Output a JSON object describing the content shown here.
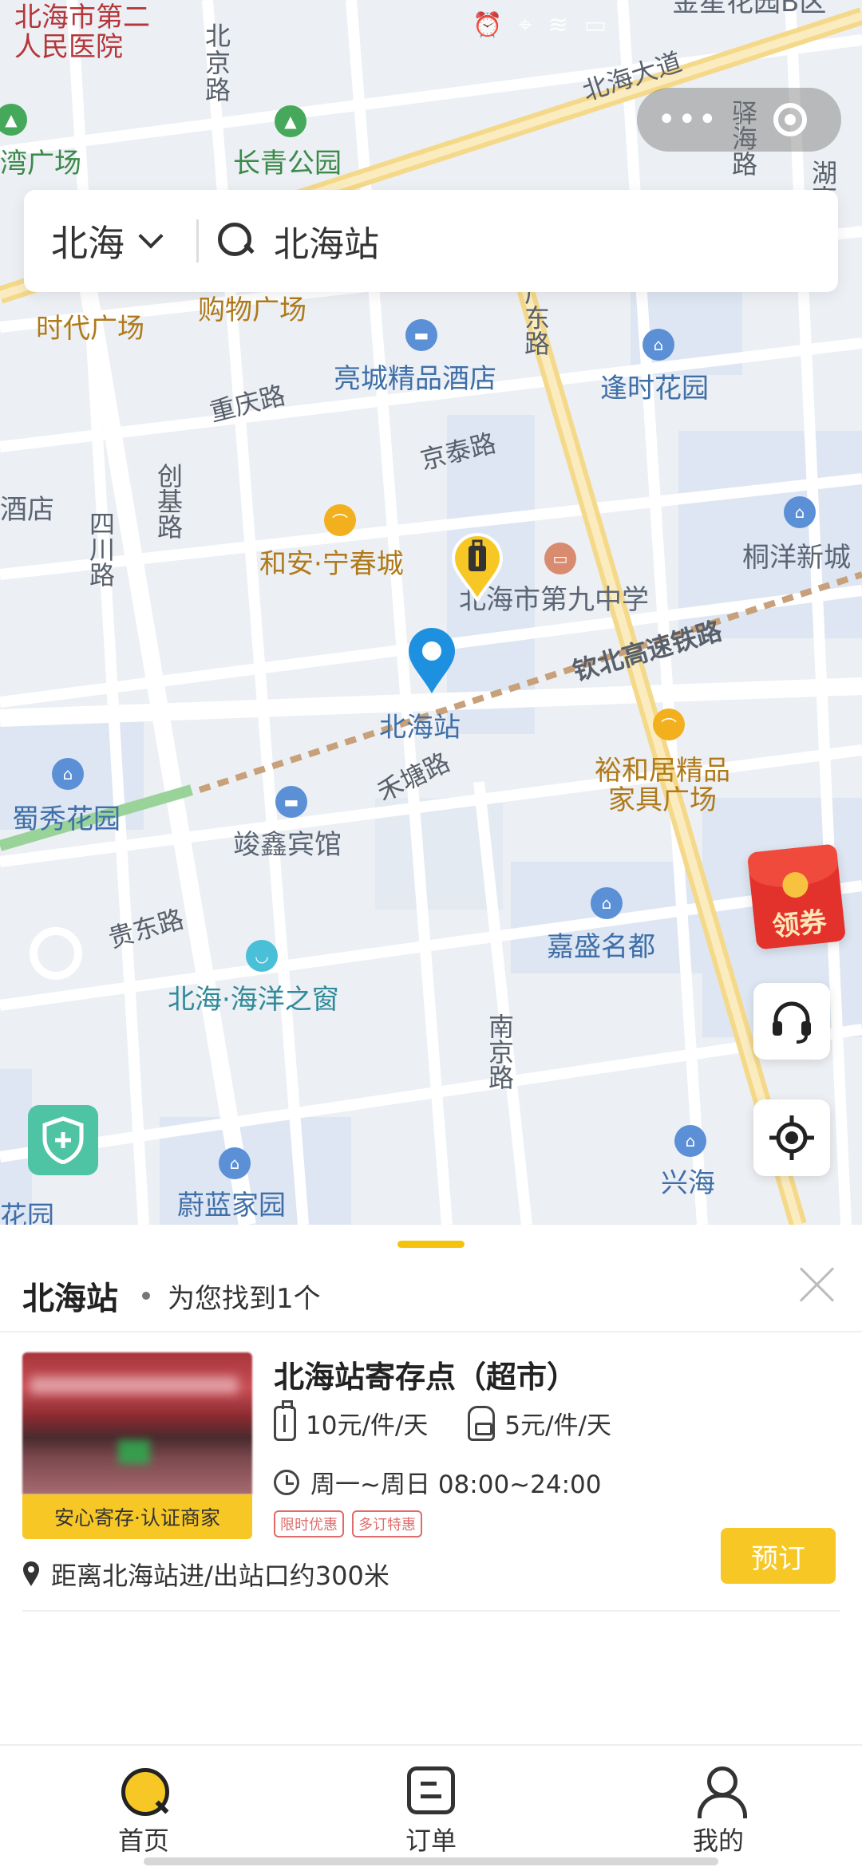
{
  "status_bar": {
    "icons": [
      "alarm-icon",
      "location-icon",
      "wifi-icon",
      "signal-icon",
      "battery-icon"
    ]
  },
  "capsule": {
    "more_label": "•••",
    "close_icon": "record-icon"
  },
  "search": {
    "city": "北海",
    "value": "北海站"
  },
  "map": {
    "labels": {
      "hospital": "北海市第二\n人民医院",
      "beijing_road": "北京路",
      "beihai_avenue": "北海大道",
      "jinxing_garden": "金星花园B区",
      "bay_square": "湾广场",
      "changqing_park": "长青公园",
      "yizhan_road": "驿海路",
      "hubei_road": "湖南路",
      "times_square": "时代广场",
      "shopping_square": "购物广场",
      "liangcheng_hotel": "亮城精品酒店",
      "guangdong_road": "广东路",
      "fengshi_garden": "逢时花园",
      "chongqing_road": "重庆路",
      "jingtai_road": "京泰路",
      "hotel_left": "酒店",
      "chuangji_road": "创基路",
      "sichuan_road": "四川路",
      "hean_ningchun": "和安·宁春城",
      "no9_middle_school": "北海市第九中学",
      "tongyang_new_city": "桐洋新城",
      "qinbei_railway": "钦北高速铁路",
      "beihai_station": "北海站",
      "yuhe_furniture": "裕和居精品\n家具广场",
      "shuxiu_garden": "蜀秀花园",
      "hetang_road": "禾塘路",
      "junxin_hotel": "竣鑫宾馆",
      "guidong_road": "贵东路",
      "jiasheng_mingdu": "嘉盛名都",
      "ocean_window": "北海·海洋之窗",
      "nanjing_road": "南京路",
      "weilan_garden": "蔚蓝家园",
      "xinghai": "兴海",
      "huayuan": "花园"
    }
  },
  "floating": {
    "coupon_label": "领券",
    "service_icon": "headset-icon",
    "locate_icon": "locate-icon",
    "shield_icon": "shield-plus-icon"
  },
  "sheet": {
    "title": "北海站",
    "result": "为您找到1个",
    "card": {
      "name": "北海站寄存点（超市）",
      "badge": "安心寄存·认证商家",
      "price_suitcase": "10元/件/天",
      "price_backpack": "5元/件/天",
      "hours": "周一~周日 08:00~24:00",
      "tags": [
        "限时优惠",
        "多订特惠"
      ],
      "distance": "距离北海站进/出站口约300米",
      "book_label": "预订"
    }
  },
  "tabbar": {
    "items": [
      {
        "label": "首页",
        "icon": "search-home-icon"
      },
      {
        "label": "订单",
        "icon": "order-icon"
      },
      {
        "label": "我的",
        "icon": "person-icon"
      }
    ]
  },
  "colors": {
    "accent": "#f6c725",
    "station_pin": "#1e90e0",
    "coupon_red": "#e2322b",
    "shield_green": "#4fc4a4"
  }
}
